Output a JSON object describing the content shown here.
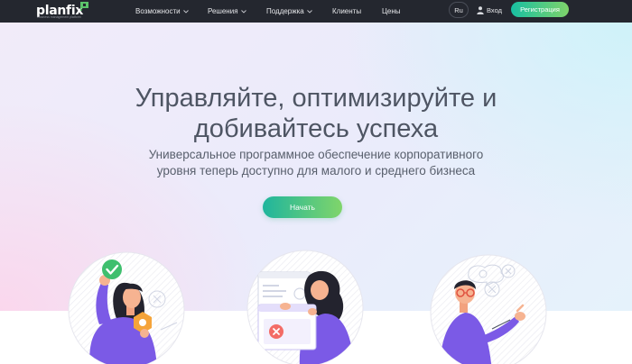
{
  "brand": {
    "name": "planfix",
    "tagline": "business management platform",
    "accent": "#7fd36a"
  },
  "nav": {
    "items": [
      {
        "label": "Возможности",
        "icon": "chevron-down-icon"
      },
      {
        "label": "Решения",
        "icon": "chevron-down-icon"
      },
      {
        "label": "Поддержка",
        "icon": "chevron-down-icon"
      },
      {
        "label": "Клиенты"
      },
      {
        "label": "Цены"
      }
    ],
    "lang": "Ru",
    "login": "Вход",
    "login_icon": "user-icon",
    "signup": "Регистрация"
  },
  "hero": {
    "headline_line1": "Управляйте, оптимизируйте и",
    "headline_line2": "добивайтесь успеха",
    "subtitle_line1": "Универсальное программное обеспечение корпоративного",
    "subtitle_line2": "уровня теперь доступно для малого и среднего бизнеса",
    "cta": "Начать"
  },
  "illustrations": [
    {
      "name": "woman-with-checkmark-illustration"
    },
    {
      "name": "woman-at-window-illustration"
    },
    {
      "name": "man-with-glasses-illustration"
    }
  ],
  "colors": {
    "topbar": "#24272f",
    "purple": "#7b5ae6",
    "green": "#3fbf6e",
    "text": "#4e5563"
  }
}
